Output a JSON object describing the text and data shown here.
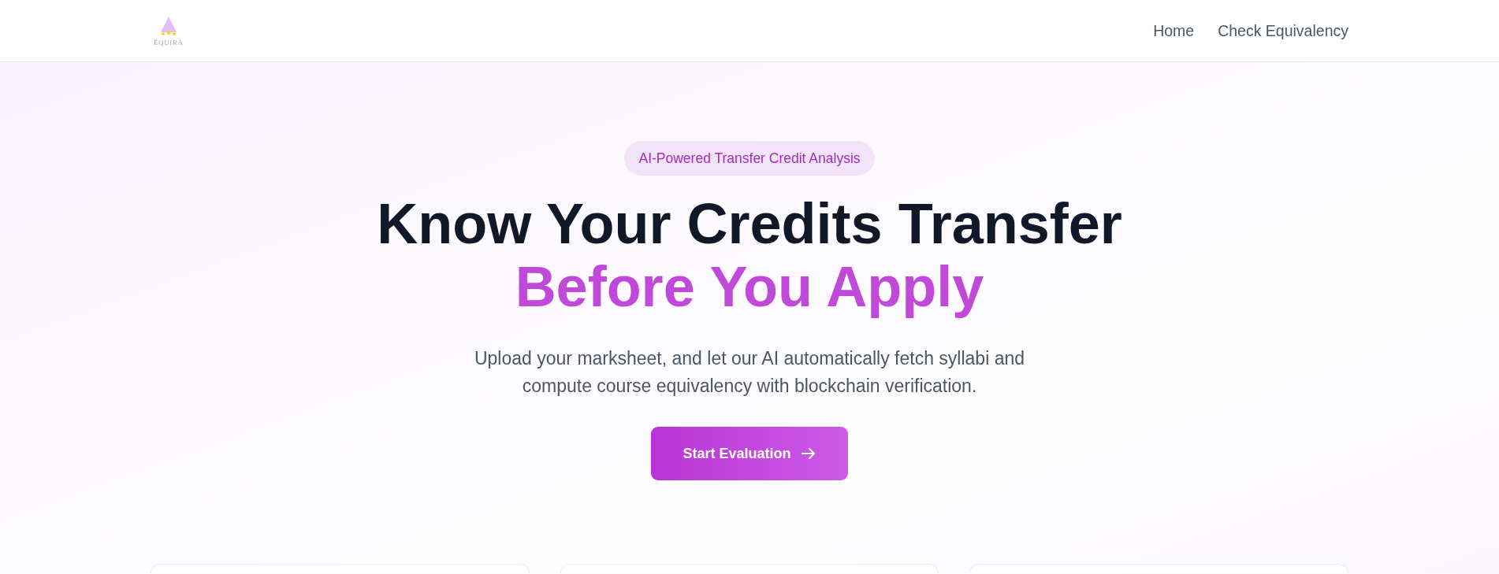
{
  "header": {
    "logo": {
      "text": "ÉQUIRA"
    },
    "nav": [
      {
        "label": "Home"
      },
      {
        "label": "Check Equivalency"
      }
    ]
  },
  "hero": {
    "badge": "AI-Powered Transfer Credit Analysis",
    "headline": "Know Your Credits Transfer",
    "headline_highlight": "Before You Apply",
    "subtitle": "Upload your marksheet, and let our AI automatically fetch syllabi and compute course equivalency with blockchain verification.",
    "cta": {
      "label": "Start Evaluation"
    }
  }
}
